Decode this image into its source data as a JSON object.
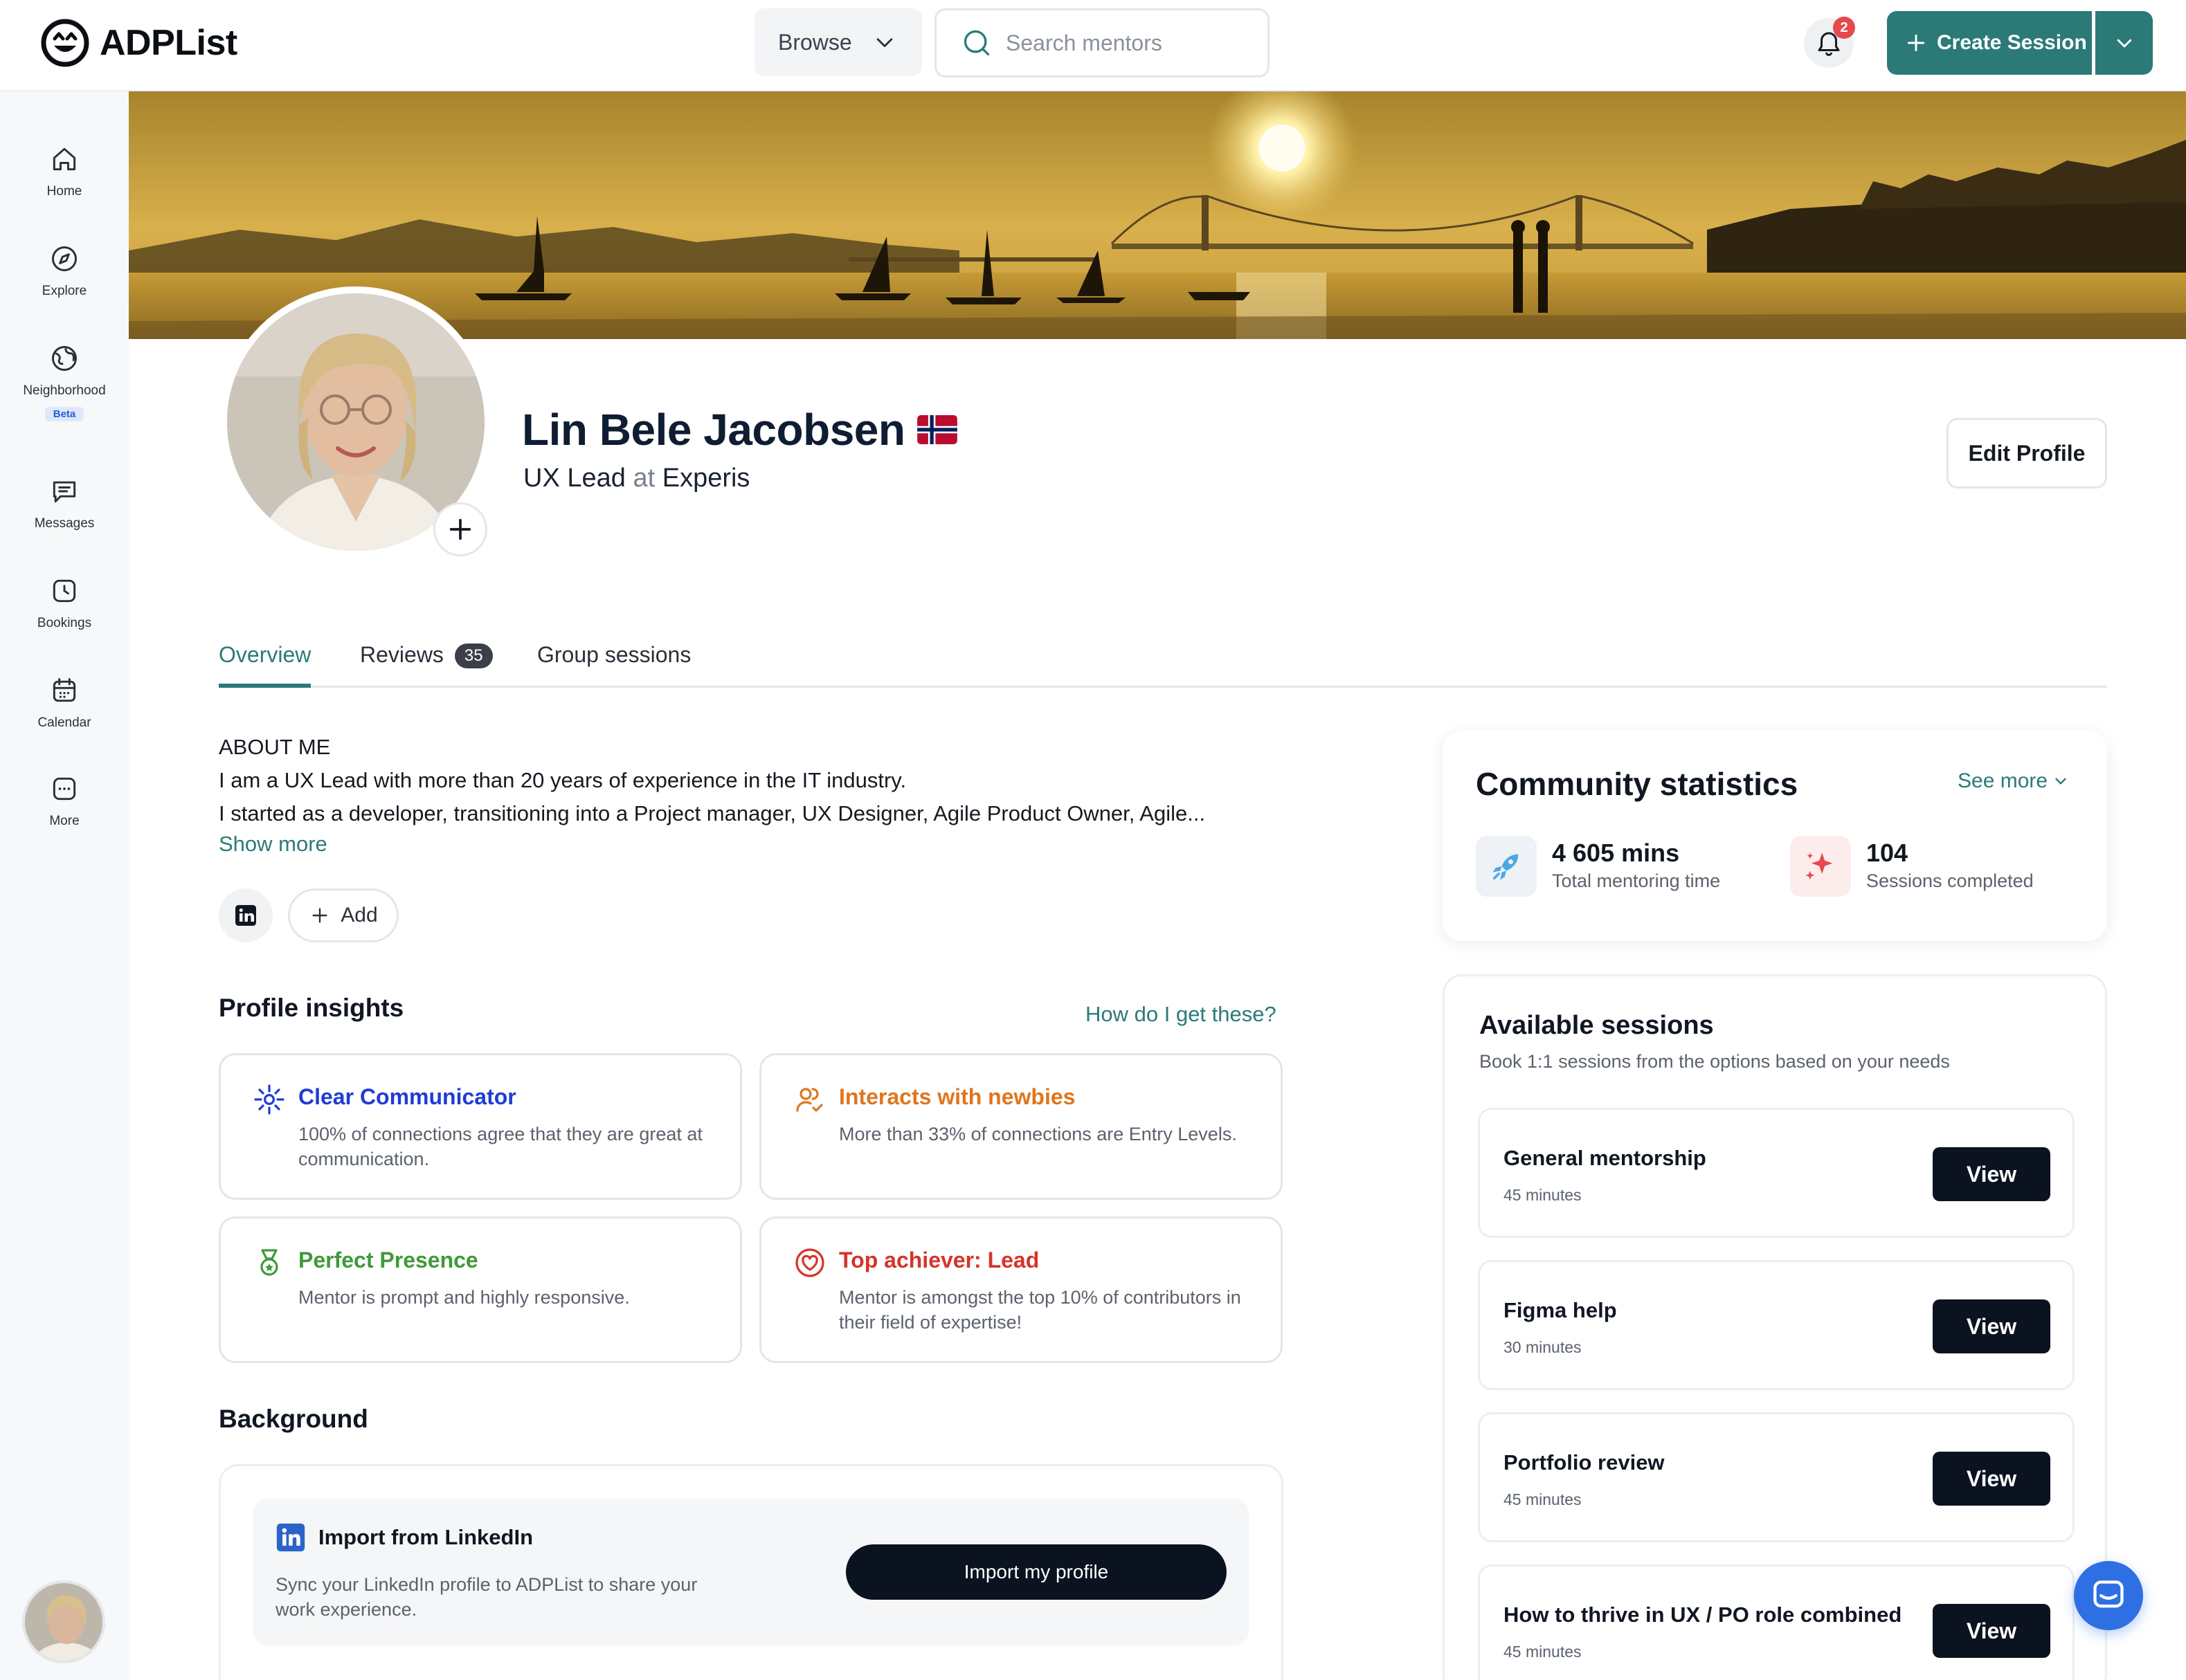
{
  "app": {
    "name": "ADPList"
  },
  "header": {
    "browse_label": "Browse",
    "search_placeholder": "Search mentors",
    "notification_count": "2",
    "create_session_label": "Create Session"
  },
  "sidebar": {
    "items": [
      {
        "label": "Home",
        "icon": "home-icon"
      },
      {
        "label": "Explore",
        "icon": "compass-icon"
      },
      {
        "label": "Neighborhood",
        "icon": "globe-icon",
        "badge": "Beta"
      },
      {
        "label": "Messages",
        "icon": "chat-icon"
      },
      {
        "label": "Bookings",
        "icon": "clock-icon"
      },
      {
        "label": "Calendar",
        "icon": "calendar-icon"
      },
      {
        "label": "More",
        "icon": "dots-icon"
      }
    ]
  },
  "profile": {
    "name": "Lin Bele Jacobsen",
    "flag": "norway-flag",
    "role": "UX Lead",
    "at": "at",
    "company": "Experis",
    "edit_label": "Edit Profile"
  },
  "tabs": [
    {
      "label": "Overview",
      "active": true
    },
    {
      "label": "Reviews",
      "count": "35"
    },
    {
      "label": "Group sessions"
    }
  ],
  "about": {
    "heading": "ABOUT ME",
    "line1": "I am a UX Lead with more than 20 years of experience in the IT industry.",
    "line2": "I started as a developer, transitioning into a Project manager, UX Designer, Agile Product Owner, Agile...",
    "show_more": "Show more",
    "add_label": "Add"
  },
  "insights": {
    "title": "Profile insights",
    "help_link": "How do I get these?",
    "items": [
      {
        "title": "Clear Communicator",
        "desc": "100% of connections agree that they are great at communication.",
        "color": "#1f3bd6",
        "icon": "sparkle-icon"
      },
      {
        "title": "Interacts with newbies",
        "desc": "More than 33% of connections are Entry Levels.",
        "color": "#e0751d",
        "icon": "users-check-icon"
      },
      {
        "title": "Perfect Presence",
        "desc": "Mentor is prompt and highly responsive.",
        "color": "#3f9a3a",
        "icon": "medal-icon"
      },
      {
        "title": "Top achiever: Lead",
        "desc": "Mentor is amongst the top 10% of contributors in their field of expertise!",
        "color": "#d6342a",
        "icon": "heart-badge-icon"
      }
    ]
  },
  "background": {
    "title": "Background",
    "import_title": "Import from LinkedIn",
    "import_desc": "Sync your LinkedIn profile to ADPList to share your work experience.",
    "import_button": "Import my profile"
  },
  "stats": {
    "title": "Community statistics",
    "see_more": "See more",
    "items": [
      {
        "value": "4 605 mins",
        "label": "Total mentoring time",
        "icon": "rocket-icon",
        "bg": "#eef1f5"
      },
      {
        "value": "104",
        "label": "Sessions completed",
        "icon": "sparkles-icon",
        "bg": "#fdecec"
      }
    ]
  },
  "sessions": {
    "title": "Available sessions",
    "subtitle": "Book 1:1 sessions from the options based on your needs",
    "view_label": "View",
    "items": [
      {
        "name": "General mentorship",
        "duration": "45 minutes"
      },
      {
        "name": "Figma help",
        "duration": "30 minutes"
      },
      {
        "name": "Portfolio review",
        "duration": "45 minutes"
      },
      {
        "name": "How to thrive in UX / PO role combined",
        "duration": "45 minutes"
      }
    ]
  },
  "colors": {
    "accent": "#2b7a78",
    "dark_button": "#0b1220",
    "chat_fab": "#2f6fe4"
  }
}
